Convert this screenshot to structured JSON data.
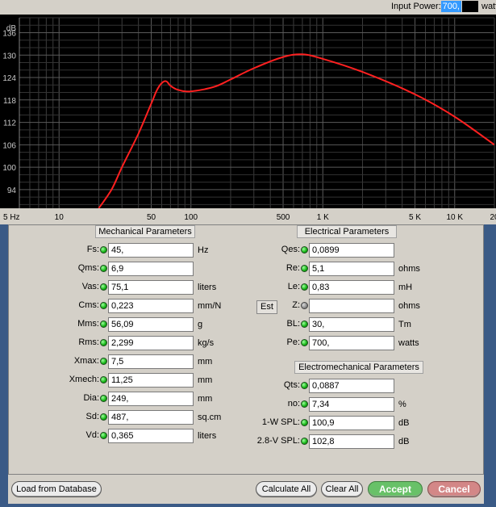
{
  "topbar": {
    "input_power_label": "Input Power:",
    "input_power_value": "700,",
    "unit": "watts"
  },
  "chart_data": {
    "type": "line",
    "ylabel": "dB",
    "ylim": [
      89,
      140
    ],
    "yticks": [
      94,
      100,
      106,
      112,
      118,
      124,
      130,
      136
    ],
    "xscale": "log",
    "xlim": [
      5,
      20000
    ],
    "xtick_labels": [
      {
        "v": 5,
        "t": "5 Hz"
      },
      {
        "v": 10,
        "t": "10"
      },
      {
        "v": 50,
        "t": "50"
      },
      {
        "v": 100,
        "t": "100"
      },
      {
        "v": 500,
        "t": "500"
      },
      {
        "v": 1000,
        "t": "1 K"
      },
      {
        "v": 5000,
        "t": "5 K"
      },
      {
        "v": 10000,
        "t": "10 K"
      },
      {
        "v": 20000,
        "t": "20"
      }
    ],
    "series": [
      {
        "color": "#ff2020",
        "x": [
          20,
          25,
          30,
          40,
          50,
          55,
          60,
          65,
          70,
          80,
          100,
          150,
          200,
          300,
          500,
          700,
          1000,
          2000,
          5000,
          10000,
          20000
        ],
        "y": [
          89,
          94,
          100,
          109,
          117,
          120.5,
          122.5,
          123,
          121.8,
          120.7,
          120.3,
          121.5,
          123.5,
          126.5,
          129.5,
          130.2,
          129,
          125.5,
          119.5,
          113.5,
          106
        ]
      }
    ],
    "grid": true,
    "line_color": "#ff2020"
  },
  "mechanical": {
    "title": "Mechanical Parameters",
    "rows": [
      {
        "label": "Fs:",
        "value": "45,",
        "unit": "Hz"
      },
      {
        "label": "Qms:",
        "value": "6,9",
        "unit": ""
      },
      {
        "label": "Vas:",
        "value": "75,1",
        "unit": "liters"
      },
      {
        "label": "Cms:",
        "value": "0,223",
        "unit": "mm/N"
      },
      {
        "label": "Mms:",
        "value": "56,09",
        "unit": "g"
      },
      {
        "label": "Rms:",
        "value": "2,299",
        "unit": "kg/s"
      },
      {
        "label": "Xmax:",
        "value": "7,5",
        "unit": "mm"
      },
      {
        "label": "Xmech:",
        "value": "11,25",
        "unit": "mm"
      },
      {
        "label": "Dia:",
        "value": "249,",
        "unit": "mm"
      },
      {
        "label": "Sd:",
        "value": "487,",
        "unit": "sq.cm"
      },
      {
        "label": "Vd:",
        "value": "0,365",
        "unit": "liters"
      }
    ]
  },
  "electrical": {
    "title": "Electrical Parameters",
    "est_label": "Est",
    "rows": [
      {
        "label": "Qes:",
        "value": "0,0899",
        "unit": ""
      },
      {
        "label": "Re:",
        "value": "5,1",
        "unit": "ohms"
      },
      {
        "label": "Le:",
        "value": "0,83",
        "unit": "mH"
      },
      {
        "label": "Z:",
        "value": "",
        "unit": "ohms"
      },
      {
        "label": "BL:",
        "value": "30,",
        "unit": "Tm"
      },
      {
        "label": "Pe:",
        "value": "700,",
        "unit": "watts"
      }
    ]
  },
  "electromechanical": {
    "title": "Electromechanical Parameters",
    "rows": [
      {
        "label": "Qts:",
        "value": "0,0887",
        "unit": ""
      },
      {
        "label": "no:",
        "value": "7,34",
        "unit": "%"
      },
      {
        "label": "1-W SPL:",
        "value": "100,9",
        "unit": "dB"
      },
      {
        "label": "2.8-V SPL:",
        "value": "102,8",
        "unit": "dB"
      }
    ]
  },
  "buttons": {
    "load": "Load from Database",
    "calc": "Calculate All",
    "clear": "Clear All",
    "accept": "Accept",
    "cancel": "Cancel"
  }
}
